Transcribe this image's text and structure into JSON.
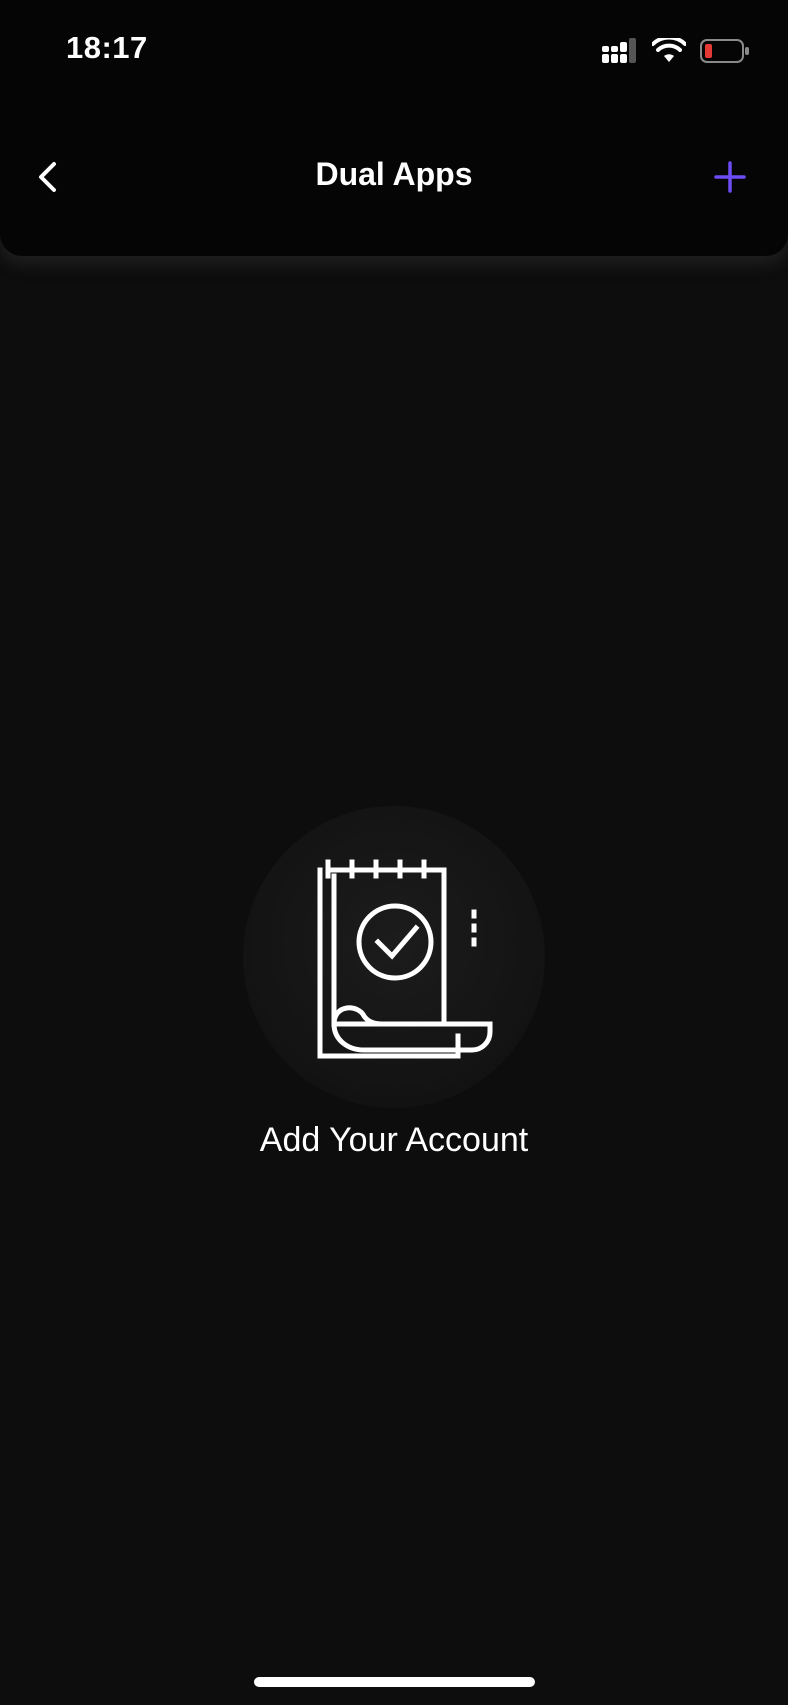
{
  "status_bar": {
    "time": "18:17",
    "battery_color": "#e53935"
  },
  "nav": {
    "title": "Dual Apps",
    "back_icon": "chevron-left-icon",
    "add_icon": "plus-icon",
    "accent_color": "#6c4cf5"
  },
  "empty_state": {
    "icon": "notepad-check-icon",
    "label": "Add Your Account"
  }
}
